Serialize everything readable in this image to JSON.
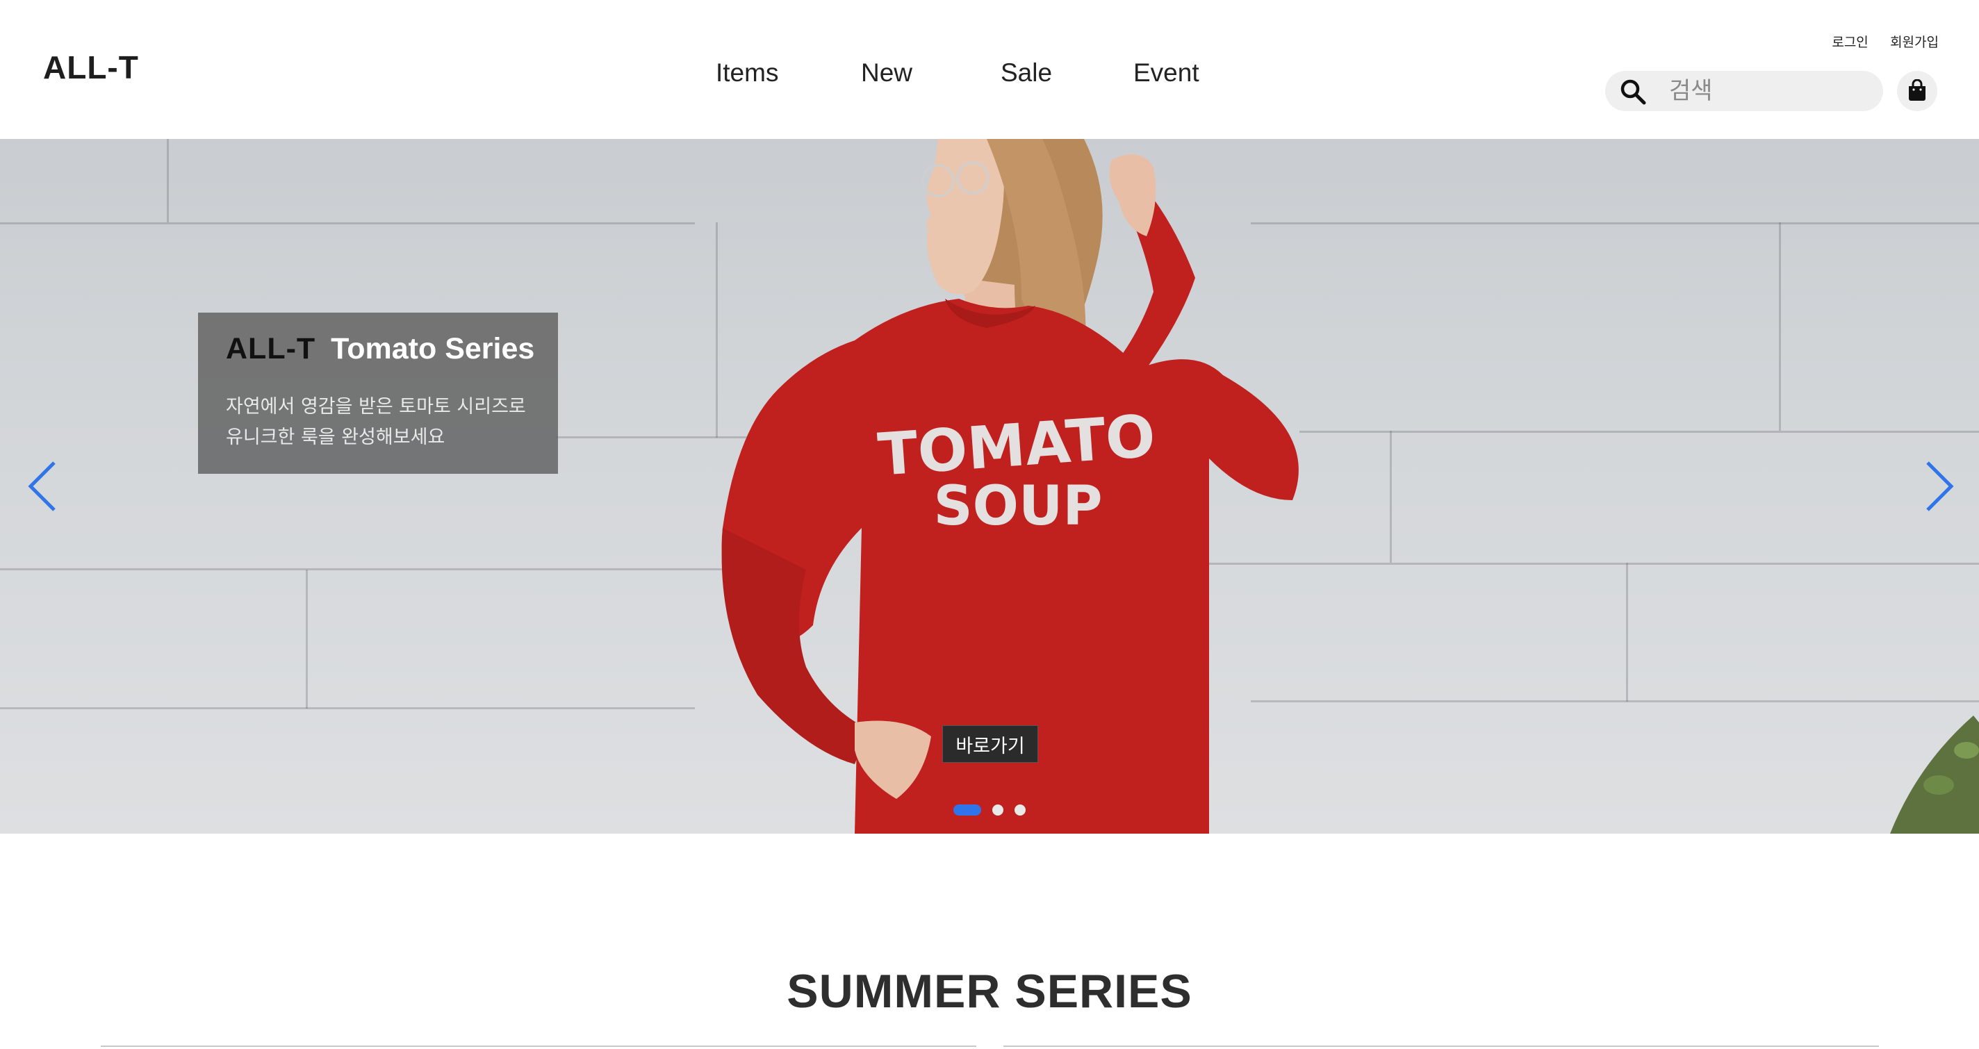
{
  "header": {
    "logo": "ALL-T",
    "nav": [
      "Items",
      "New",
      "Sale",
      "Event"
    ],
    "auth": {
      "login": "로그인",
      "signup": "회원가입"
    },
    "search": {
      "placeholder": "검색"
    }
  },
  "hero": {
    "caption": {
      "brand": "ALL-T",
      "series": "Tomato Series",
      "line1": "자연에서 영감을 받은 토마토 시리즈로",
      "line2": "유니크한 룩을 완성해보세요"
    },
    "shirt_text": {
      "line1": "TOMATO",
      "line2": "SOUP"
    },
    "button": "바로가기",
    "slides": {
      "count": 3,
      "active": 1
    }
  },
  "section": {
    "title": "SUMMER SERIES"
  },
  "colors": {
    "accent": "#2f74e8",
    "shirt": "#c0211f",
    "caption_bg": "#5f5f5f",
    "text_dark": "#2e2e2e"
  },
  "icons": {
    "search": "search-icon",
    "cart": "shopping-bag-icon",
    "prev": "chevron-left-icon",
    "next": "chevron-right-icon"
  }
}
